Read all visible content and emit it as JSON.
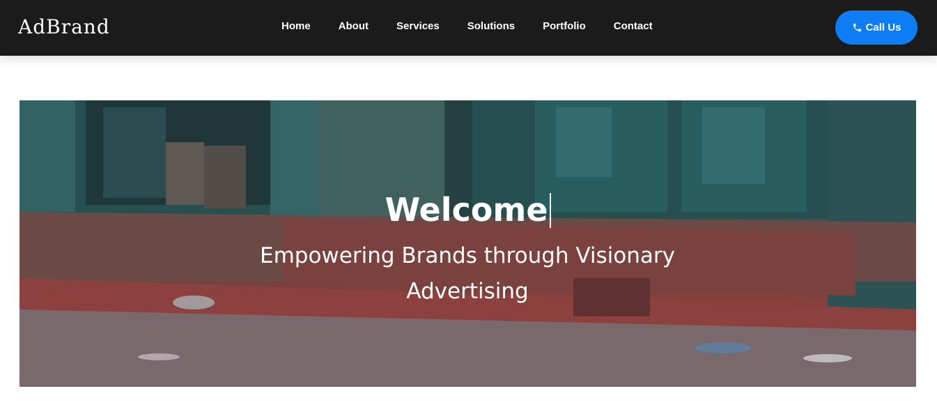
{
  "header": {
    "brand": "AdBrand",
    "nav": [
      {
        "label": "Home"
      },
      {
        "label": "About"
      },
      {
        "label": "Services"
      },
      {
        "label": "Solutions"
      },
      {
        "label": "Portfolio"
      },
      {
        "label": "Contact"
      }
    ],
    "call_button": {
      "label": "Call Us",
      "icon": "phone-icon",
      "color": "#0d7cf5"
    }
  },
  "hero": {
    "title": "Welcome",
    "subtitle": "Empowering Brands through Visionary Advertising"
  }
}
